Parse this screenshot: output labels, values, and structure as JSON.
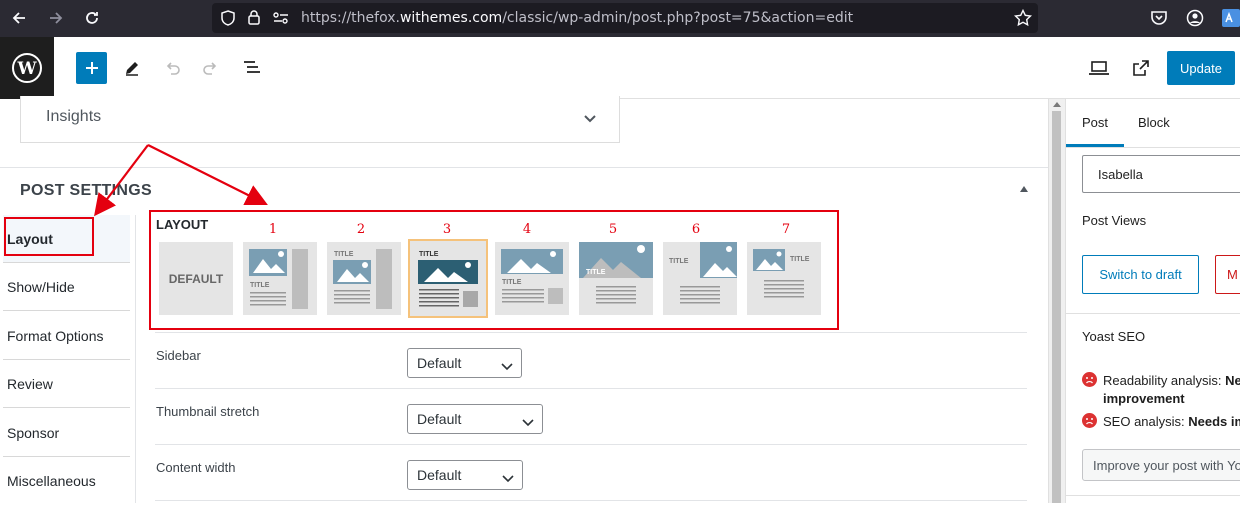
{
  "browser": {
    "url_prefix": "https://thefox.",
    "url_domain": "withemes.com",
    "url_path": "/classic/wp-admin/post.php?post=75&action=edit"
  },
  "toolbar": {
    "update_label": "Update"
  },
  "main": {
    "insights_label": "Insights",
    "section_title": "POST SETTINGS",
    "tabs": [
      {
        "label": "Layout"
      },
      {
        "label": "Show/Hide"
      },
      {
        "label": "Format Options"
      },
      {
        "label": "Review"
      },
      {
        "label": "Sponsor"
      },
      {
        "label": "Miscellaneous"
      }
    ],
    "layout": {
      "label": "LAYOUT",
      "default_label": "DEFAULT",
      "title_word": "TITLE",
      "numbers": [
        "1",
        "2",
        "3",
        "4",
        "5",
        "6",
        "7"
      ]
    },
    "fields": [
      {
        "label": "Sidebar",
        "value": "Default"
      },
      {
        "label": "Thumbnail stretch",
        "value": "Default"
      },
      {
        "label": "Content width",
        "value": "Default"
      }
    ]
  },
  "sidebar": {
    "tab_post": "Post",
    "tab_block": "Block",
    "author_value": "Isabella",
    "post_views_label": "Post Views",
    "switch_to_draft": "Switch to draft",
    "trash_partial": "M",
    "yoast_title": "Yoast SEO",
    "readability_label": "Readability analysis: ",
    "readability_value_a": "Nee",
    "readability_value_b": "improvement",
    "seo_label": "SEO analysis: ",
    "seo_value": "Needs im",
    "improve_text": "Improve your post with Yo"
  },
  "colors": {
    "accent": "#007cba",
    "annotation_red": "#e4000f",
    "selected_border": "#f5c27b",
    "thumb_blue": "#7a9eb3"
  }
}
